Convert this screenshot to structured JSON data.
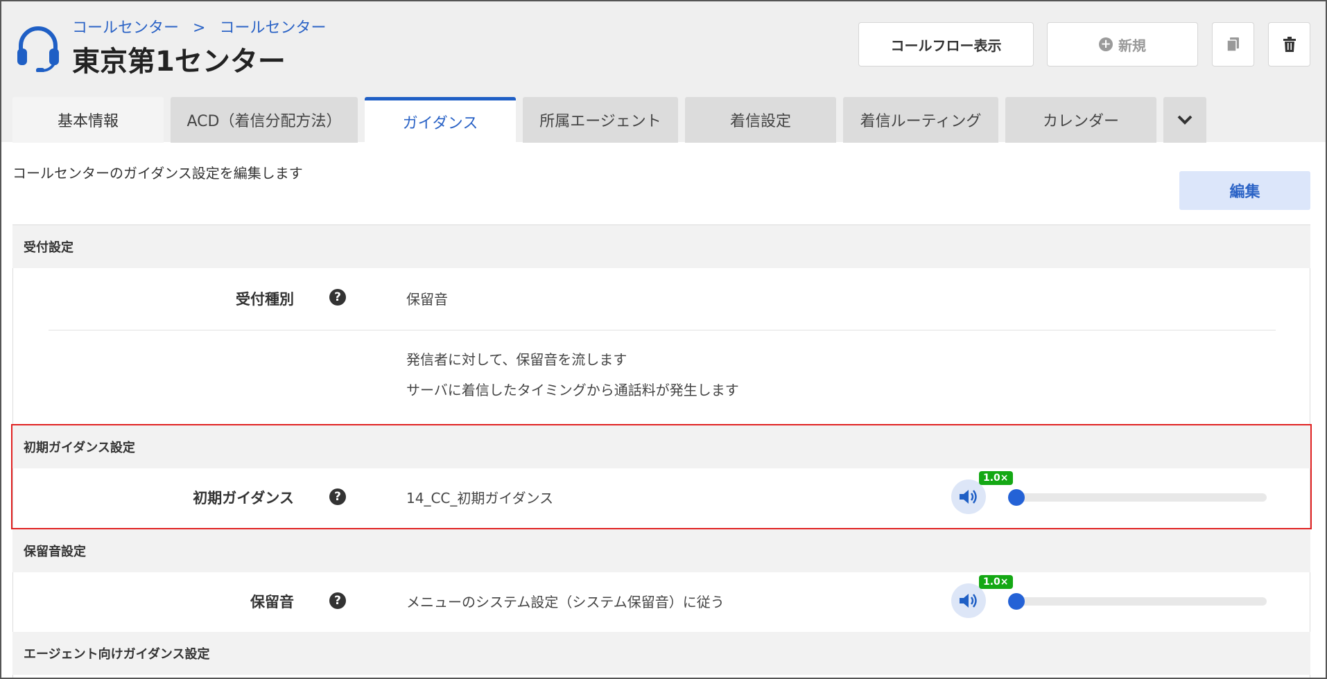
{
  "header": {
    "breadcrumb": [
      "コールセンター",
      "コールセンター"
    ],
    "breadcrumb_separator": ">",
    "title": "東京第1センター",
    "buttons": {
      "call_flow": "コールフロー表示",
      "new": "新規",
      "copy_icon": "copy-icon",
      "delete_icon": "trash-icon"
    }
  },
  "tabs": [
    {
      "label": "基本情報"
    },
    {
      "label": "ACD（着信分配方法）"
    },
    {
      "label": "ガイダンス",
      "active": true
    },
    {
      "label": "所属エージェント"
    },
    {
      "label": "着信設定"
    },
    {
      "label": "着信ルーティング"
    },
    {
      "label": "カレンダー"
    }
  ],
  "content": {
    "description": "コールセンターのガイダンス設定を編集します",
    "edit_button": "編集",
    "sections": {
      "reception": {
        "heading": "受付設定",
        "label": "受付種別",
        "value": "保留音",
        "note_lines": [
          "発信者に対して、保留音を流します",
          "サーバに着信したタイミングから通話料が発生します"
        ]
      },
      "initial_guidance": {
        "heading": "初期ガイダンス設定",
        "label": "初期ガイダンス",
        "value": "14_CC_初期ガイダンス",
        "playback_speed": "1.0×",
        "playback_progress": 0
      },
      "hold_music": {
        "heading": "保留音設定",
        "label": "保留音",
        "value": "メニューのシステム設定（システム保留音）に従う",
        "playback_speed": "1.0×",
        "playback_progress": 0
      },
      "agent_guidance": {
        "heading": "エージェント向けガイダンス設定"
      }
    }
  },
  "colors": {
    "accent": "#1f5fc5",
    "highlight_border": "#e02020",
    "speed_badge": "#14a814"
  }
}
